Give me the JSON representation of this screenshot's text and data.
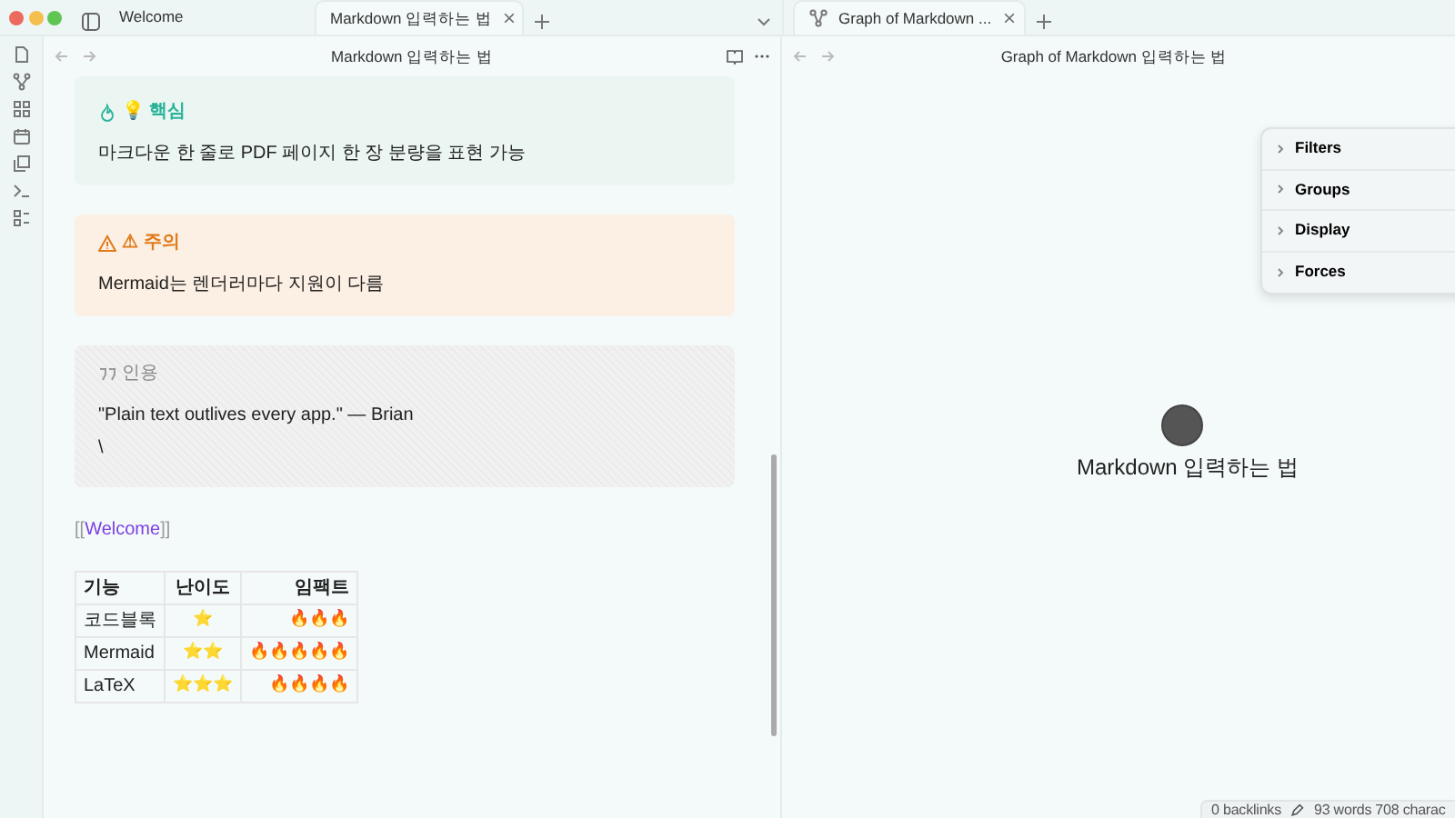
{
  "tabs_left": [
    {
      "label": "Welcome",
      "selected": false
    },
    {
      "label": "Markdown 입력하는 법",
      "selected": true
    }
  ],
  "tabs_right": [
    {
      "label": "Graph of Markdown ...",
      "selected": true
    }
  ],
  "left_header": {
    "title": "Markdown 입력하는 법"
  },
  "right_header": {
    "title": "Graph of Markdown 입력하는 법"
  },
  "callouts": [
    {
      "kind": "tip",
      "title": "💡 핵심",
      "body": "마크다운 한 줄로 PDF 페이지 한 장 분량을 표현 가능"
    },
    {
      "kind": "warning",
      "title": "⚠ 주의",
      "body": "Mermaid는 렌더러마다 지원이 다름"
    },
    {
      "kind": "quote",
      "title": "인용",
      "body": "\"Plain text outlives every app.\" — Brian",
      "extra": "\\"
    }
  ],
  "wikilink": {
    "open": "[[",
    "target": "Welcome",
    "close": "]]"
  },
  "table": {
    "columns": [
      "기능",
      "난이도",
      "임팩트"
    ],
    "rows": [
      {
        "feature": "코드블록",
        "difficulty": "⭐",
        "impact": "🔥🔥🔥"
      },
      {
        "feature": "Mermaid",
        "difficulty": "⭐⭐",
        "impact": "🔥🔥🔥🔥🔥"
      },
      {
        "feature": "LaTeX",
        "difficulty": "⭐⭐⭐",
        "impact": "🔥🔥🔥🔥"
      }
    ]
  },
  "graph": {
    "node_label": "Markdown 입력하는 법"
  },
  "graph_controls": [
    {
      "label": "Filters",
      "expanded": false
    },
    {
      "label": "Groups",
      "expanded": false
    },
    {
      "label": "Display",
      "expanded": false
    },
    {
      "label": "Forces",
      "expanded": false
    }
  ],
  "status_bar": {
    "backlinks": "0 backlinks",
    "words": "93 words",
    "chars": "708 charac"
  }
}
